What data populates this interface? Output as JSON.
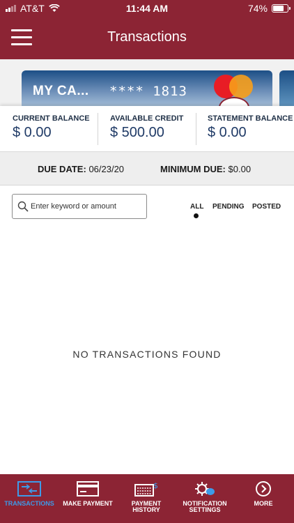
{
  "status_bar": {
    "carrier": "AT&T",
    "time": "11:44 AM",
    "battery": "74%",
    "battery_level": 0.74
  },
  "header": {
    "title": "Transactions",
    "menu_icon": "hamburger-menu-icon"
  },
  "card": {
    "name": "MY CA...",
    "number": "**** 1813",
    "network_icon": "mastercard-logo"
  },
  "balances": [
    {
      "label": "CURRENT BALANCE",
      "value": "$ 0.00"
    },
    {
      "label": "AVAILABLE CREDIT",
      "value": "$ 500.00"
    },
    {
      "label": "STATEMENT BALANCE",
      "value": "$ 0.00"
    }
  ],
  "due": {
    "due_date_label": "DUE DATE:",
    "due_date_value": "06/23/20",
    "minimum_due_label": "MINIMUM DUE:",
    "minimum_due_value": "$0.00"
  },
  "search": {
    "placeholder": "Enter keyword or amount",
    "icon": "search-icon"
  },
  "filters": {
    "all": "ALL",
    "pending": "PENDING",
    "posted": "POSTED",
    "selected": "ALL"
  },
  "empty_message": "NO TRANSACTIONS FOUND",
  "tabs": [
    {
      "label": "TRANSACTIONS",
      "icon": "transactions-icon",
      "active": true
    },
    {
      "label": "MAKE PAYMENT",
      "icon": "card-payment-icon",
      "active": false
    },
    {
      "label": "PAYMENT\nHISTORY",
      "icon": "payment-history-icon",
      "active": false
    },
    {
      "label": "NOTIFICATION\nSETTINGS",
      "icon": "notification-settings-icon",
      "active": false
    },
    {
      "label": "MORE",
      "icon": "more-icon",
      "active": false
    }
  ],
  "colors": {
    "brand": "#8c2434",
    "active_tab": "#3d9be9",
    "balance_value": "#1f3a66"
  }
}
